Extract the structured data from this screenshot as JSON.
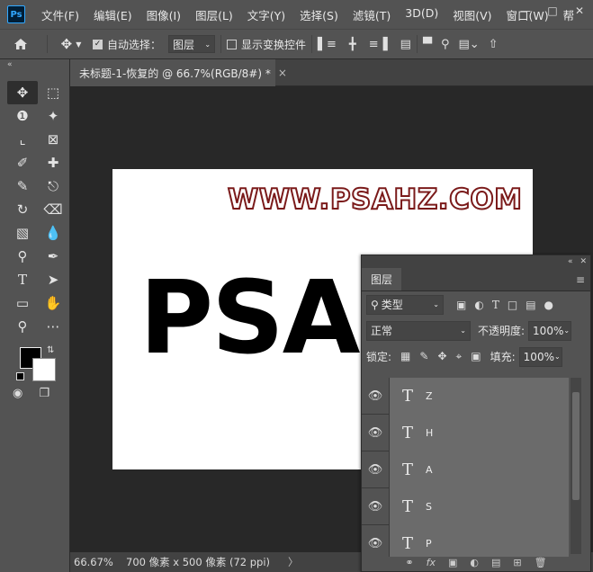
{
  "app": {
    "logo": "Ps"
  },
  "menu": [
    "文件(F)",
    "编辑(E)",
    "图像(I)",
    "图层(L)",
    "文字(Y)",
    "选择(S)",
    "滤镜(T)",
    "3D(D)",
    "视图(V)",
    "窗口(W)",
    "帮"
  ],
  "options_bar": {
    "auto_select_label": "自动选择：",
    "auto_select_checked": true,
    "auto_select_target": "图层",
    "show_transform_label": "显示变换控件",
    "show_transform_checked": false
  },
  "document": {
    "tab_title": "未标题-1-恢复的 @ 66.7%(RGB/8#) *",
    "close_glyph": "×",
    "watermark": "WWW.PSAHZ.COM",
    "big_text": "PSA"
  },
  "status": {
    "zoom": "66.67%",
    "info": "700 像素 x 500 像素 (72 ppi)",
    "arrow": "〉"
  },
  "layers_panel": {
    "tab": "图层",
    "filter_kind": "类型",
    "blend_mode": "正常",
    "opacity_label": "不透明度:",
    "opacity_value": "100%",
    "lock_label": "锁定:",
    "fill_label": "填充:",
    "fill_value": "100%",
    "layers": [
      {
        "name": "Z",
        "type": "T",
        "visible": true
      },
      {
        "name": "H",
        "type": "T",
        "visible": true
      },
      {
        "name": "A",
        "type": "T",
        "visible": true
      },
      {
        "name": "S",
        "type": "T",
        "visible": true
      },
      {
        "name": "P",
        "type": "T",
        "visible": true
      }
    ]
  },
  "colors": {
    "foreground": "#000000",
    "background": "#ffffff",
    "watermark_outline": "#7a1a1a"
  }
}
